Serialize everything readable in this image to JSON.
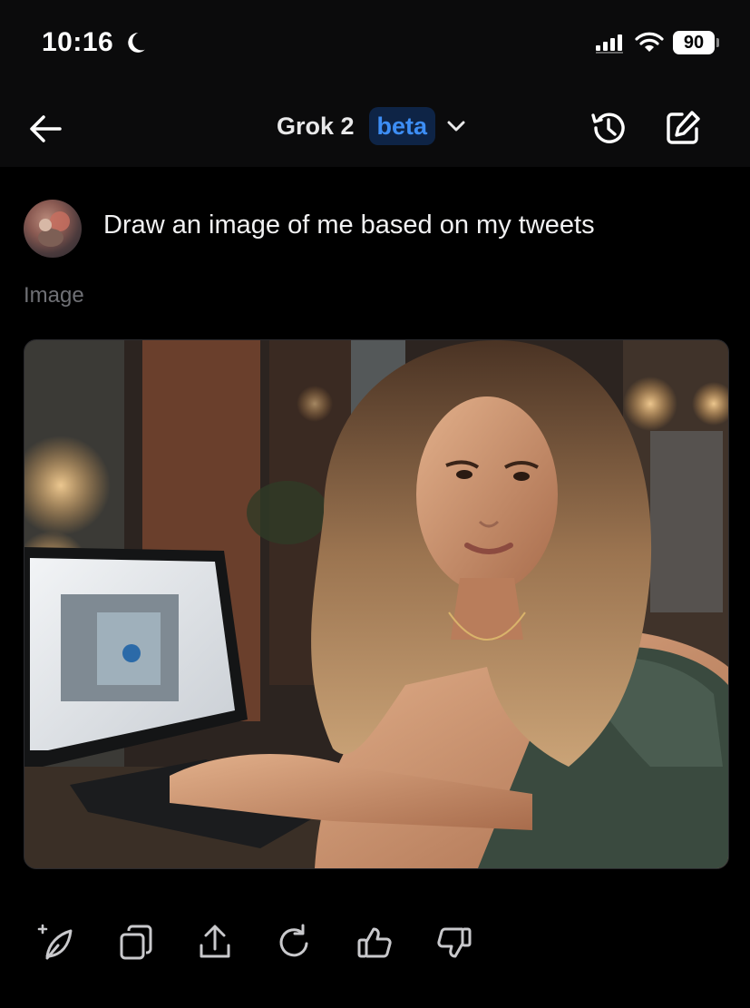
{
  "status_bar": {
    "time": "10:16",
    "battery": "90",
    "icons": [
      "moon-icon",
      "signal-icon",
      "wifi-icon",
      "battery-icon"
    ]
  },
  "header": {
    "title": "Grok 2",
    "badge": "beta",
    "icons": [
      "back-arrow-icon",
      "chevron-down-icon",
      "history-icon",
      "new-chat-icon"
    ]
  },
  "message": {
    "prompt": "Draw an image of me based on my tweets"
  },
  "response": {
    "label": "Image",
    "image_alt": "generated image: smiling woman with long wavy hair sitting at a laptop in a warmly lit cafe"
  },
  "action_bar": {
    "icons": [
      "regenerate-sparkle-icon",
      "copy-icon",
      "share-icon",
      "refresh-icon",
      "thumbs-up-icon",
      "thumbs-down-icon"
    ]
  },
  "colors": {
    "background": "#000000",
    "bar": "#0b0b0c",
    "accent": "#3d8ef5",
    "badge_bg": "#0e2446",
    "muted": "#6f7075"
  }
}
